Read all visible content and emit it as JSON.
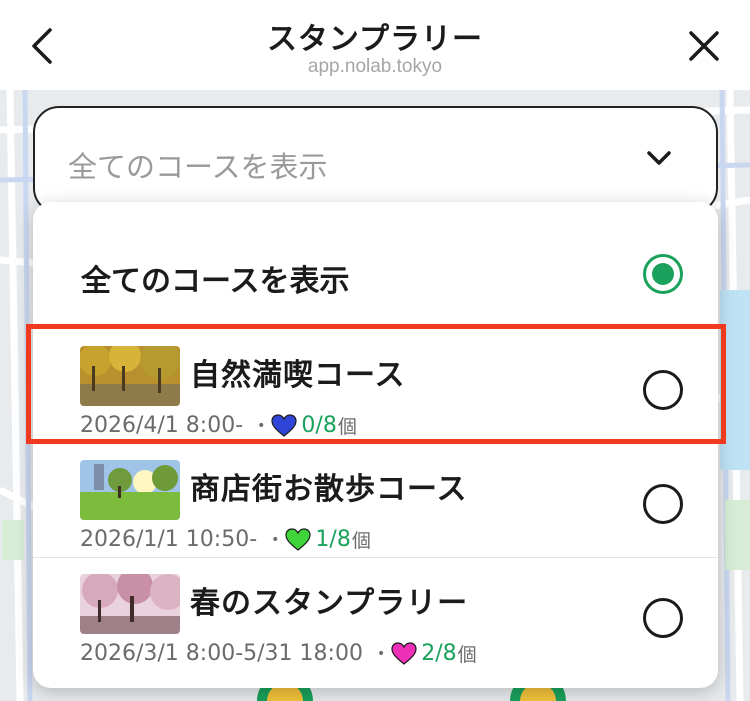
{
  "header": {
    "title": "スタンプラリー",
    "url": "app.nolab.tokyo",
    "back_icon": "chevron-left-icon",
    "close_icon": "close-icon"
  },
  "select": {
    "current_value": "全てのコースを表示",
    "chevron_icon": "chevron-down-icon"
  },
  "dropdown": {
    "all_option": {
      "label": "全てのコースを表示",
      "selected": true
    },
    "courses": [
      {
        "name": "自然満喫コース",
        "schedule": "2026/4/1 8:00-",
        "separator": "•",
        "progress": "0/8",
        "unit": "個",
        "heart_color": "#2f45d8",
        "selected": false,
        "highlighted": true
      },
      {
        "name": "商店街お散歩コース",
        "schedule": "2026/1/1 10:50-",
        "separator": "•",
        "progress": "1/8",
        "unit": "個",
        "heart_color": "#3fd43a",
        "selected": false,
        "highlighted": false
      },
      {
        "name": "春のスタンプラリー",
        "schedule": "2026/3/1 8:00-5/31 18:00",
        "separator": "•",
        "progress": "2/8",
        "unit": "個",
        "heart_color": "#ee2fb8",
        "selected": false,
        "highlighted": false
      }
    ]
  },
  "colors": {
    "accent_green": "#1aa15c",
    "highlight_red": "#f03a1e"
  }
}
